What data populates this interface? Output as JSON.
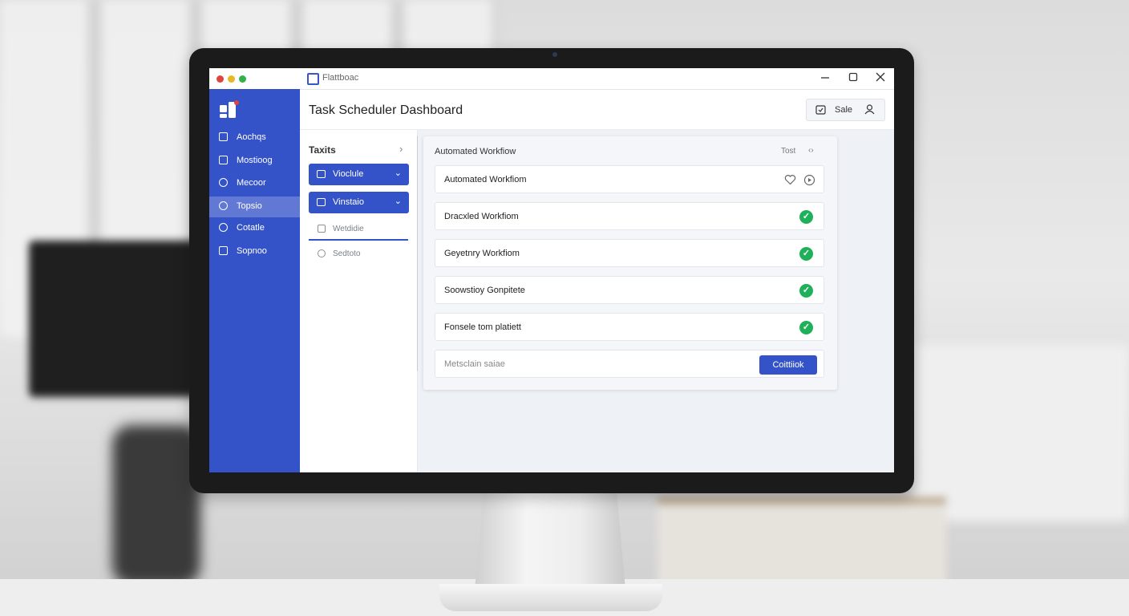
{
  "window": {
    "title": "Flattboac"
  },
  "sidebar": {
    "items": [
      {
        "label": "Aochqs",
        "icon": "folder-icon"
      },
      {
        "label": "Mostioog",
        "icon": "grid-icon"
      },
      {
        "label": "Mecoor",
        "icon": "circle-icon"
      },
      {
        "label": "Topsio",
        "icon": "target-icon",
        "active": true
      },
      {
        "label": "Cotatle",
        "icon": "chat-icon"
      },
      {
        "label": "Sopnoo",
        "icon": "document-icon"
      }
    ]
  },
  "header": {
    "title": "Task Scheduler Dashboard",
    "action_label": "Sale"
  },
  "tasks": {
    "header": "Taxits",
    "buttons": [
      {
        "label": "Vioclule"
      },
      {
        "label": "Vinstaio"
      }
    ],
    "subitems": [
      {
        "label": "Wetdidie"
      },
      {
        "label": "Sedtoto"
      }
    ]
  },
  "workflow_card": {
    "title": "Automated Workfiow",
    "meta": "Tost",
    "meta_arrows": "‹›",
    "rows": [
      {
        "label": "Automated Workfiom",
        "status": "icons"
      },
      {
        "label": "Dracxled Workfiom",
        "status": "complete"
      },
      {
        "label": "Geyetnry Workfiom",
        "status": "complete"
      },
      {
        "label": "Soowstioy Gonpitete",
        "status": "complete"
      },
      {
        "label": "Fonsele tom platiett",
        "status": "complete"
      }
    ],
    "input_placeholder": "Metsclain saiae",
    "commit_label": "Coittiiok"
  },
  "colors": {
    "brand": "#3553c9",
    "success": "#1fb15a",
    "traffic_red": "#e0443e",
    "traffic_yellow": "#e7b825",
    "traffic_green": "#2fb34a"
  }
}
